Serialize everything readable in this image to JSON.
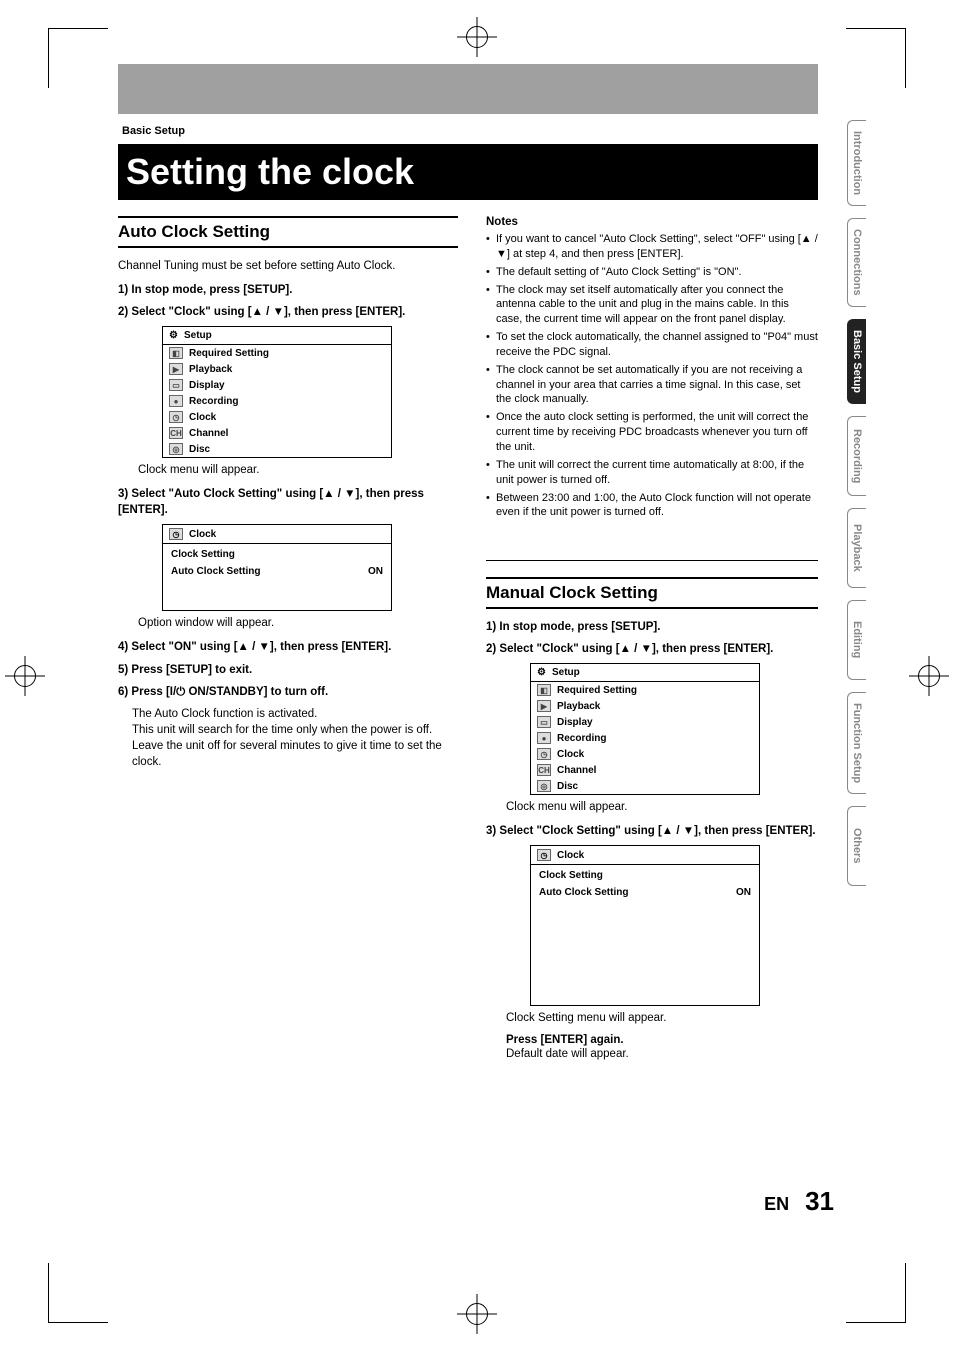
{
  "breadcrumb": "Basic Setup",
  "page_title": "Setting the clock",
  "section_auto": {
    "title": "Auto Clock Setting",
    "intro": "Channel Tuning must be set before setting Auto Clock.",
    "step1": "1) In stop mode, press [SETUP].",
    "step2_a": "2) Select \"Clock\" using [",
    "step2_b": "], then press [ENTER].",
    "caption1": "Clock menu will appear.",
    "step3_a": "3) Select \"Auto Clock Setting\" using [",
    "step3_b": "], then press [ENTER].",
    "caption2": "Option window will appear.",
    "step4_a": "4) Select \"ON\" using [",
    "step4_b": "], then press [ENTER].",
    "step5": "5) Press [SETUP] to exit.",
    "step6": "6) Press [I/⏻ ON/STANDBY] to turn off.",
    "step6_body1": "The Auto Clock function is activated.",
    "step6_body2": "This unit will search for the time only when the power is off.  Leave the unit off for several minutes to give it time to set the clock."
  },
  "setup_menu": {
    "title": "Setup",
    "items": [
      "Required Setting",
      "Playback",
      "Display",
      "Recording",
      "Clock",
      "Channel",
      "Disc"
    ]
  },
  "clock_menu": {
    "title": "Clock",
    "row1": "Clock Setting",
    "row2_label": "Auto Clock Setting",
    "row2_value": "ON"
  },
  "notes": {
    "title": "Notes",
    "items": [
      "If you want to cancel \"Auto Clock Setting\", select \"OFF\" using [▲ / ▼] at step 4, and then press [ENTER].",
      "The default setting of \"Auto Clock Setting\" is \"ON\".",
      "The clock may set itself automatically after you connect the antenna cable to the unit and plug in the mains cable. In this case, the current time will appear on the front panel display.",
      "To set the clock automatically, the channel assigned to \"P04\" must receive the PDC signal.",
      "The clock cannot be set automatically if you are not receiving a channel in your area that carries a time signal. In this case, set the clock manually.",
      "Once the auto clock setting is performed, the unit will correct the current time by receiving PDC broadcasts whenever you turn off the unit.",
      "The unit will correct the current time automatically at 8:00, if the unit power is turned off.",
      "Between 23:00 and 1:00, the Auto Clock function will not operate even if the unit power is turned off."
    ]
  },
  "section_manual": {
    "title": "Manual Clock Setting",
    "step1": "1) In stop mode, press [SETUP].",
    "step2_a": "2) Select \"Clock\" using [",
    "step2_b": "], then press [ENTER].",
    "caption1": "Clock menu will appear.",
    "step3_a": "3) Select \"Clock Setting\" using [",
    "step3_b": "], then press [ENTER].",
    "caption2": "Clock Setting menu will appear.",
    "press_enter": "Press [ENTER] again.",
    "default_date": "Default date will appear."
  },
  "side_tabs": [
    "Introduction",
    "Connections",
    "Basic Setup",
    "Recording",
    "Playback",
    "Editing",
    "Function Setup",
    "Others"
  ],
  "side_active_index": 2,
  "footer": {
    "lang": "EN",
    "page": "31"
  },
  "arrows": "▲ / ▼"
}
